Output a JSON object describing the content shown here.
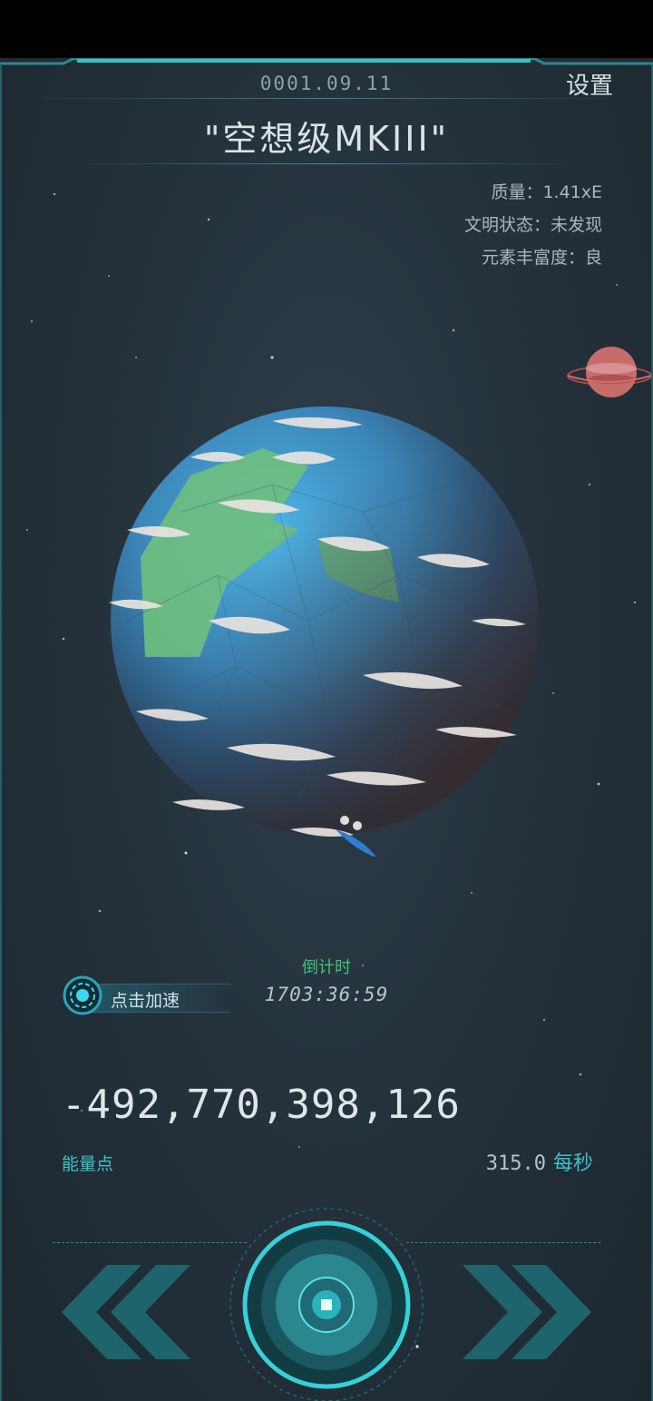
{
  "header": {
    "date": "0001.09.11",
    "settings_label": "设置",
    "planet_name": "\"空想级MKIII\""
  },
  "stats": {
    "mass": "质量：1.41xE",
    "civilization": "文明状态：未发现",
    "elements": "元素丰富度：良"
  },
  "boost": {
    "label": "点击加速",
    "countdown_label": "倒计时",
    "countdown": "1703:36:59"
  },
  "energy": {
    "value": "-492,770,398,126",
    "label": "能量点",
    "rate": "315.0",
    "rate_unit": "每秒"
  },
  "colors": {
    "accent": "#3fc1c7",
    "countdown_label": "#3ec37a",
    "background": "#25323c"
  },
  "icons": {
    "prev": "double-chevron-left-icon",
    "next": "double-chevron-right-icon",
    "center": "center-target-icon",
    "boost": "boost-ring-icon"
  }
}
